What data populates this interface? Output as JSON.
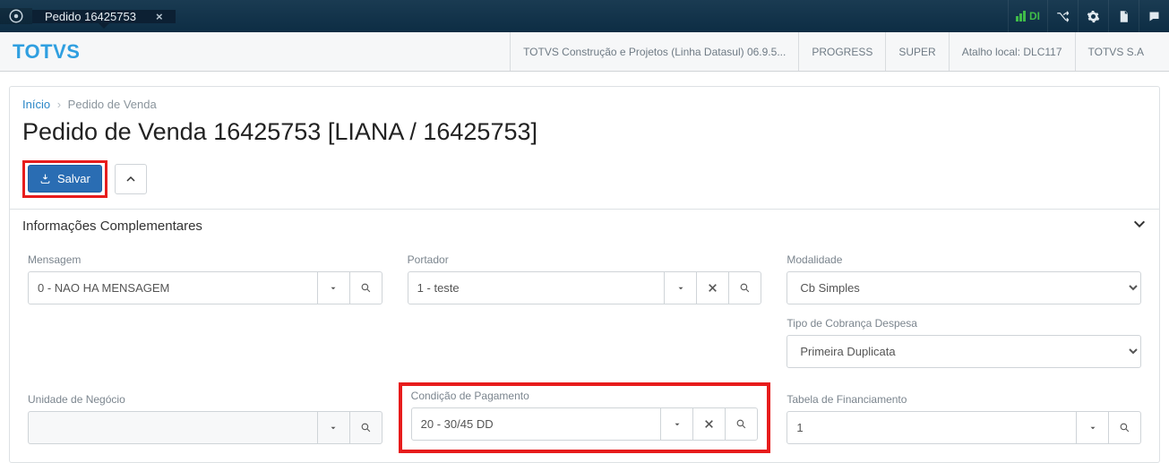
{
  "tab": {
    "title": "Pedido 16425753",
    "close": "×"
  },
  "topbar": {
    "di": "DI"
  },
  "brand": {
    "logo": "TOTVS",
    "crumbs": [
      "TOTVS Construção e Projetos (Linha Datasul) 06.9.5...",
      "PROGRESS",
      "SUPER",
      "Atalho local: DLC117",
      "TOTVS S.A"
    ]
  },
  "breadcrumb": {
    "home": "Início",
    "current": "Pedido de Venda"
  },
  "page_title": "Pedido de Venda 16425753 [LIANA / 16425753]",
  "actions": {
    "salvar": "Salvar"
  },
  "section": {
    "title": "Informações Complementares"
  },
  "fields": {
    "mensagem": {
      "label": "Mensagem",
      "value": "0 - NAO HA MENSAGEM"
    },
    "portador": {
      "label": "Portador",
      "value": "1 - teste"
    },
    "modalidade": {
      "label": "Modalidade",
      "value": "Cb Simples"
    },
    "tipo_cobranca": {
      "label": "Tipo de Cobrança Despesa",
      "value": "Primeira Duplicata"
    },
    "unidade_negocio": {
      "label": "Unidade de Negócio",
      "value": ""
    },
    "condicao_pagamento": {
      "label": "Condição de Pagamento",
      "value": "20 - 30/45 DD"
    },
    "tabela_financiamento": {
      "label": "Tabela de Financiamento",
      "value": "1"
    }
  }
}
